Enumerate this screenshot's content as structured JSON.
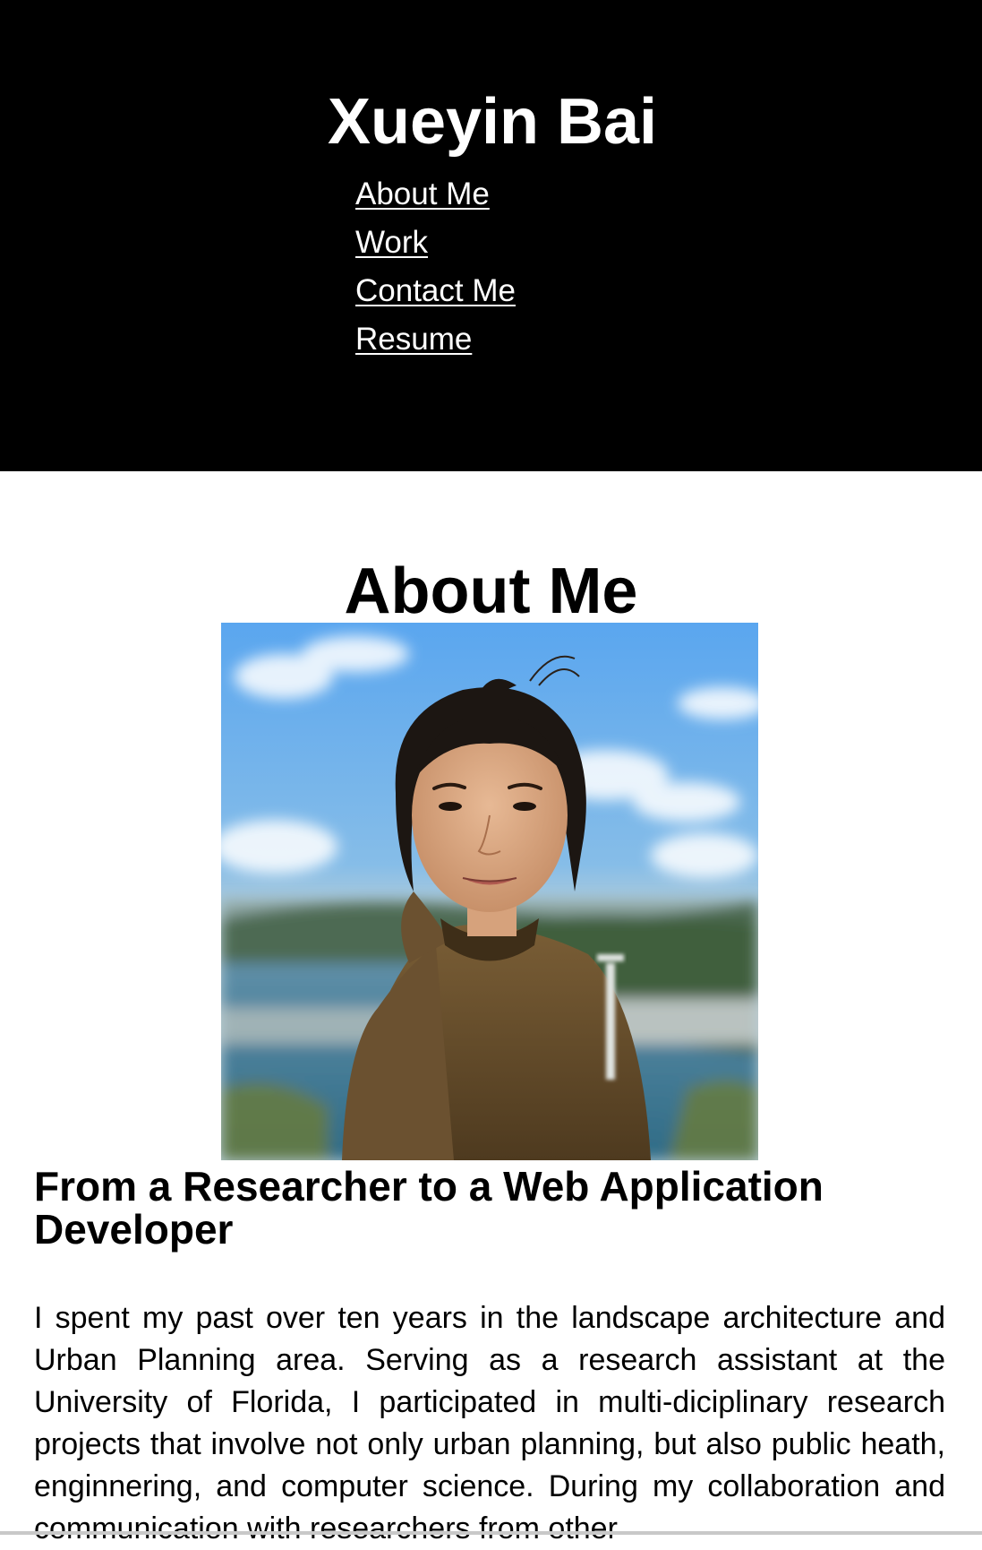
{
  "header": {
    "site_title": "Xueyin Bai",
    "nav": [
      {
        "label": "About Me"
      },
      {
        "label": "Work"
      },
      {
        "label": "Contact Me"
      },
      {
        "label": "Resume"
      }
    ]
  },
  "about": {
    "title": "About Me",
    "subheading": "From a Researcher to a Web Application Developer",
    "bio": "I spent my past over ten years in the landscape architecture and Urban Planning area. Serving as a research assistant at the University of Florida, I participated in multi-diciplinary research projects that involve not only urban planning, but also public heath, enginnering, and computer science. During my collaboration and communication with researchers from other"
  },
  "colors": {
    "header_bg": "#000000",
    "header_text": "#ffffff",
    "page_bg": "#ffffff",
    "body_text": "#000000"
  }
}
